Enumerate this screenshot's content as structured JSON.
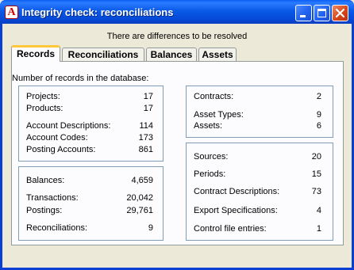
{
  "window": {
    "title": "Integrity check: reconciliations",
    "app_icon_letter": "A"
  },
  "message": "There are differences to be resolved",
  "tabs": [
    {
      "label": "Records",
      "active": true
    },
    {
      "label": "Reconciliations",
      "active": false
    },
    {
      "label": "Balances",
      "active": false
    },
    {
      "label": "Assets",
      "active": false
    }
  ],
  "records": {
    "caption": "Number of records in the database:",
    "group1": [
      {
        "label": "Projects:",
        "value": "17"
      },
      {
        "label": "Products:",
        "value": "17"
      },
      {
        "label": "Account Descriptions:",
        "value": "114"
      },
      {
        "label": "Account Codes:",
        "value": "173"
      },
      {
        "label": "Posting Accounts:",
        "value": "861"
      }
    ],
    "group2": [
      {
        "label": "Balances:",
        "value": "4,659"
      },
      {
        "label": "Transactions:",
        "value": "20,042"
      },
      {
        "label": "Postings:",
        "value": "29,761"
      },
      {
        "label": "Reconciliations:",
        "value": "9"
      }
    ],
    "group3": [
      {
        "label": "Contracts:",
        "value": "2"
      },
      {
        "label": "Asset Types:",
        "value": "9"
      },
      {
        "label": "Assets:",
        "value": "6"
      }
    ],
    "group4": [
      {
        "label": "Sources:",
        "value": "20"
      },
      {
        "label": "Periods:",
        "value": "15"
      },
      {
        "label": "Contract Descriptions:",
        "value": "73"
      },
      {
        "label": "Export Specifications:",
        "value": "4"
      },
      {
        "label": "Control file entries:",
        "value": "1"
      }
    ]
  }
}
